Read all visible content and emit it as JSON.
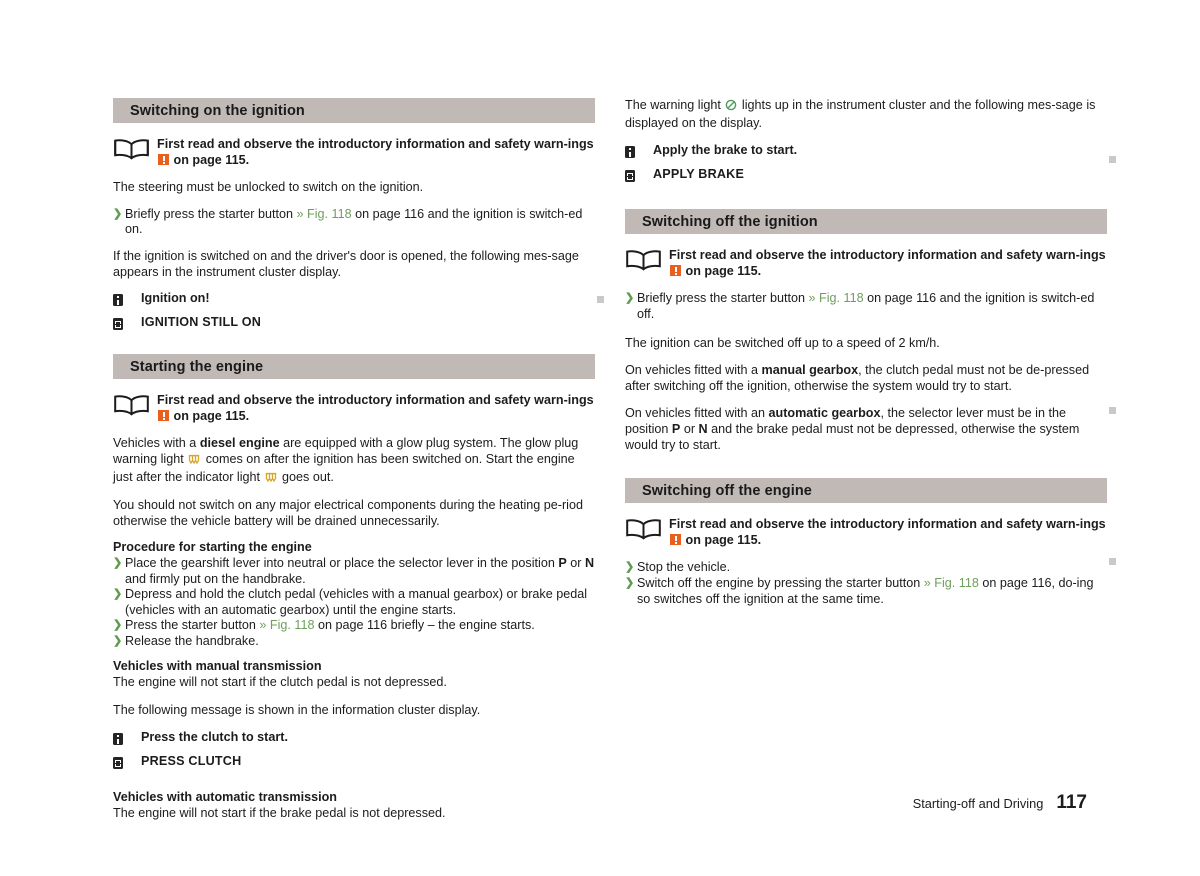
{
  "page": {
    "number": "117",
    "chapter": "Starting-off and Driving"
  },
  "colors": {
    "section_bar": "#c0b9b6",
    "fig_link": "#6f9e5c",
    "chevron": "#5f9c4e",
    "warning_orange": "#e8601c",
    "badge_dark": "#242424",
    "glow_amber": "#d8a52b",
    "brake_green": "#4f9c5a",
    "margin_marker": "#c9c9c9",
    "text": "#1c1c1c"
  },
  "icons": {
    "book": "open-book-icon",
    "warning": "orange-exclamation-icon",
    "info_badge": "info-badge-icon",
    "screen_badge": "display-badge-icon",
    "glow_plug": "glow-plug-warning-light-icon",
    "brake": "brake-warning-light-icon",
    "chevron": "green-chevron-bullet"
  },
  "left_column": {
    "section1": {
      "title": "Switching on the ignition",
      "reference": {
        "text_before": "First read and observe the introductory information and safety warn‑ings ",
        "text_after": " on page 115."
      },
      "para1": "The steering must be unlocked to switch on the ignition.",
      "bullet1": {
        "before": "Briefly press the starter button ",
        "link": "» Fig. 118",
        "after": " on page 116 and the ignition is switch‑ed on."
      },
      "para2": "If the ignition is switched on and the driver's door is opened, the following mes‑sage appears in the instrument cluster display.",
      "messages": [
        {
          "icon": "info-badge-icon",
          "text": "Ignition on!"
        },
        {
          "icon": "display-badge-icon",
          "text": "IGNITION STILL ON"
        }
      ]
    },
    "section2": {
      "title": "Starting the engine",
      "reference": {
        "text_before": "First read and observe the introductory information and safety warn‑ings ",
        "text_after": " on page 115."
      },
      "para_diesel": {
        "p1": "Vehicles with a ",
        "b1": "diesel engine",
        "p2": " are equipped with a glow plug system. The glow plug warning light ",
        "p3": " comes on after the ignition has been switched on. Start the engine just after the indicator light ",
        "p4": " goes out."
      },
      "para_electrical": "You should not switch on any major electrical components during the heating pe‑riod otherwise the vehicle battery will be drained unnecessarily.",
      "procedure_title": "Procedure for starting the engine",
      "procedure": [
        {
          "parts": [
            {
              "t": "Place the gearshift lever into neutral or place the selector lever in the position "
            },
            {
              "t": "P",
              "b": true
            },
            {
              "t": " or "
            },
            {
              "t": "N",
              "b": true
            },
            {
              "t": " and firmly put on the handbrake."
            }
          ]
        },
        {
          "parts": [
            {
              "t": "Depress and hold the clutch pedal (vehicles with a manual gearbox) or brake pedal (vehicles with an automatic gearbox) until the engine starts."
            }
          ]
        },
        {
          "parts": [
            {
              "t": "Press the starter button "
            },
            {
              "t": "» Fig. 118",
              "link": true
            },
            {
              "t": " on page 116 briefly – the engine starts."
            }
          ]
        },
        {
          "parts": [
            {
              "t": "Release the handbrake."
            }
          ]
        }
      ],
      "manual_head": "Vehicles with manual transmission",
      "manual_text": "The engine will not start if the clutch pedal is not depressed.",
      "cluster_intro": "The following message is shown in the information cluster display.",
      "messages": [
        {
          "icon": "info-badge-icon",
          "text": "Press the clutch to start."
        },
        {
          "icon": "display-badge-icon",
          "text": "PRESS CLUTCH"
        }
      ],
      "auto_head": "Vehicles with automatic transmission",
      "auto_text": "The engine will not start if the brake pedal is not depressed."
    }
  },
  "right_column": {
    "intro": {
      "p1": "The warning light ",
      "p2": " lights up in the instrument cluster and the following mes‑sage is displayed on the display.",
      "messages": [
        {
          "icon": "info-badge-icon",
          "text": "Apply the brake to start."
        },
        {
          "icon": "display-badge-icon",
          "text": "APPLY BRAKE"
        }
      ]
    },
    "section1": {
      "title": "Switching off the ignition",
      "reference": {
        "text_before": "First read and observe the introductory information and safety warn‑ings ",
        "text_after": " on page 115."
      },
      "bullet1": {
        "before": "Briefly press the starter button ",
        "link": "» Fig. 118",
        "after": " on page 116 and the ignition is switch‑ed off."
      },
      "para_speed": "The ignition can be switched off up to a speed of 2 km/h.",
      "para_manual": {
        "p1": "On vehicles fitted with a ",
        "b1": "manual gearbox",
        "p2": ", the clutch pedal must not be de‑pressed after switching off the ignition, otherwise the system would try to start."
      },
      "para_auto": {
        "p1": "On vehicles fitted with an ",
        "b1": "automatic gearbox",
        "p2": ", the selector lever must be in the position ",
        "b2": "P",
        "p3": " or ",
        "b3": "N",
        "p4": " and the brake pedal must not be depressed, otherwise the system would try to start."
      }
    },
    "section2": {
      "title": "Switching off the engine",
      "reference": {
        "text_before": "First read and observe the introductory information and safety warn‑ings ",
        "text_after": " on page 115."
      },
      "bullets": [
        {
          "parts": [
            {
              "t": "Stop the vehicle."
            }
          ]
        },
        {
          "parts": [
            {
              "t": "Switch off the engine by pressing the starter button "
            },
            {
              "t": "» Fig. 118",
              "link": true
            },
            {
              "t": " on page 116, do‑ing so switches off the ignition at the same time."
            }
          ]
        }
      ]
    }
  }
}
